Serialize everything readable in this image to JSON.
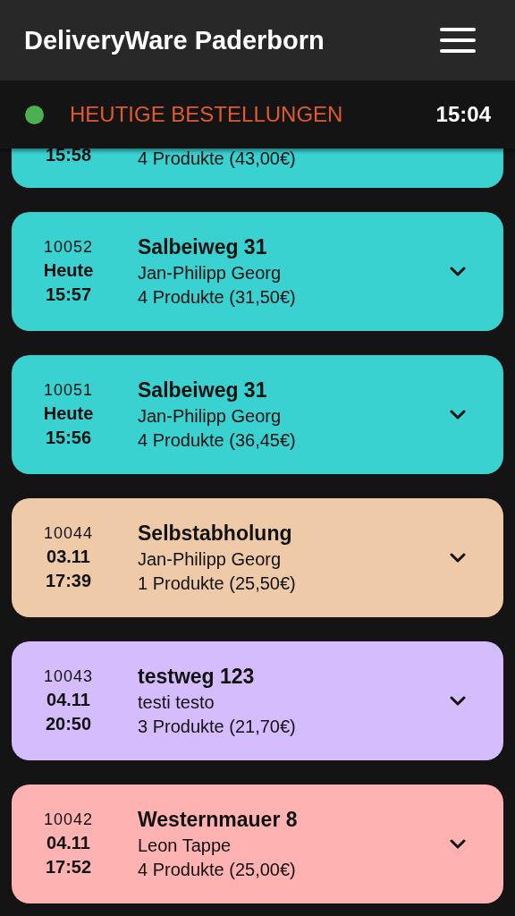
{
  "header": {
    "title": "DeliveryWare Paderborn"
  },
  "subheader": {
    "connected": true,
    "title": "HEUTIGE BESTELLUNGEN",
    "time": "15:04"
  },
  "orders": [
    {
      "partial": true,
      "time": "15:58",
      "products": "4 Produkte (43,00€)",
      "color": "#3ad1d1"
    },
    {
      "partial": false,
      "id": "10052",
      "day": "Heute",
      "time": "15:57",
      "address": "Salbeiweg 31",
      "customer": "Jan-Philipp Georg",
      "products": "4 Produkte (31,50€)",
      "color": "#3ad1d1"
    },
    {
      "partial": false,
      "id": "10051",
      "day": "Heute",
      "time": "15:56",
      "address": "Salbeiweg 31",
      "customer": "Jan-Philipp Georg",
      "products": "4 Produkte (36,45€)",
      "color": "#3ad1d1"
    },
    {
      "partial": false,
      "id": "10044",
      "day": "03.11",
      "time": "17:39",
      "address": "Selbstabholung",
      "customer": "Jan-Philipp Georg",
      "products": "1 Produkte (25,50€)",
      "color": "#eecaa9"
    },
    {
      "partial": false,
      "id": "10043",
      "day": "04.11",
      "time": "20:50",
      "address": "testweg 123",
      "customer": "testi testo",
      "products": "3 Produkte (21,70€)",
      "color": "#d5bdfd"
    },
    {
      "partial": false,
      "id": "10042",
      "day": "04.11",
      "time": "17:52",
      "address": "Westernmauer 8",
      "customer": "Leon Tappe",
      "products": "4 Produkte (25,00€)",
      "color": "#feb2b2"
    }
  ]
}
